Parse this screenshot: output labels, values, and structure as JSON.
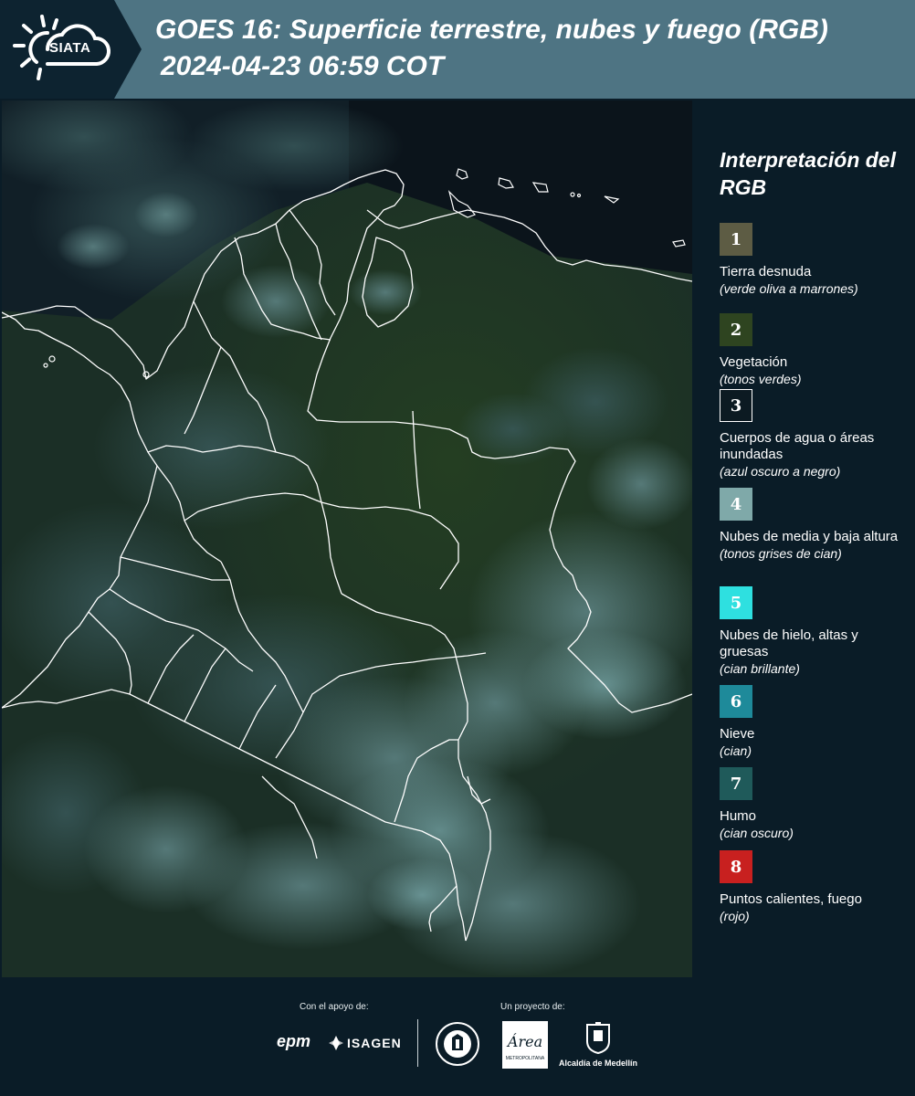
{
  "header": {
    "logo_text": "SIATA",
    "title": "GOES 16: Superficie terrestre, nubes y fuego (RGB)",
    "subtitle": "2024-04-23 06:59 COT"
  },
  "legend": {
    "title": "Interpretación del RGB",
    "items": [
      {
        "number": "1",
        "label": "Tierra desnuda",
        "description": "(verde oliva a marrones)",
        "color": "#5d5c44"
      },
      {
        "number": "2",
        "label": "Vegetación",
        "description": "(tonos verdes)",
        "color": "#2e4420"
      },
      {
        "number": "3",
        "label": "Cuerpos de agua o áreas inundadas",
        "description": "(azul oscuro a negro)",
        "color": "#0c1a22"
      },
      {
        "number": "4",
        "label": "Nubes de media y baja altura",
        "description": "(tonos grises de cian)",
        "color": "#7fa9a9"
      },
      {
        "number": "5",
        "label": "Nubes de hielo, altas y gruesas",
        "description": "(cian brillante)",
        "color": "#2ee0e0"
      },
      {
        "number": "6",
        "label": "Nieve",
        "description": "(cian)",
        "color": "#1e8a9a"
      },
      {
        "number": "7",
        "label": "Humo",
        "description": "(cian oscuro)",
        "color": "#1f5a5a"
      },
      {
        "number": "8",
        "label": "Puntos calientes, fuego",
        "description": "(rojo)",
        "color": "#c8201f"
      }
    ]
  },
  "footer": {
    "support_label": "Con el apoyo de:",
    "project_label": "Un proyecto de:",
    "epm": "epm",
    "isagen": "ISAGEN",
    "area_logo_text": "Área",
    "area_sub": "METROPOLITANA",
    "alcaldia": "Alcaldía de Medellín"
  },
  "colors": {
    "header_bg": "#4e7483",
    "header_dark": "#0d2330",
    "page_bg": "#0a1c27",
    "border_line": "#ffffff"
  }
}
